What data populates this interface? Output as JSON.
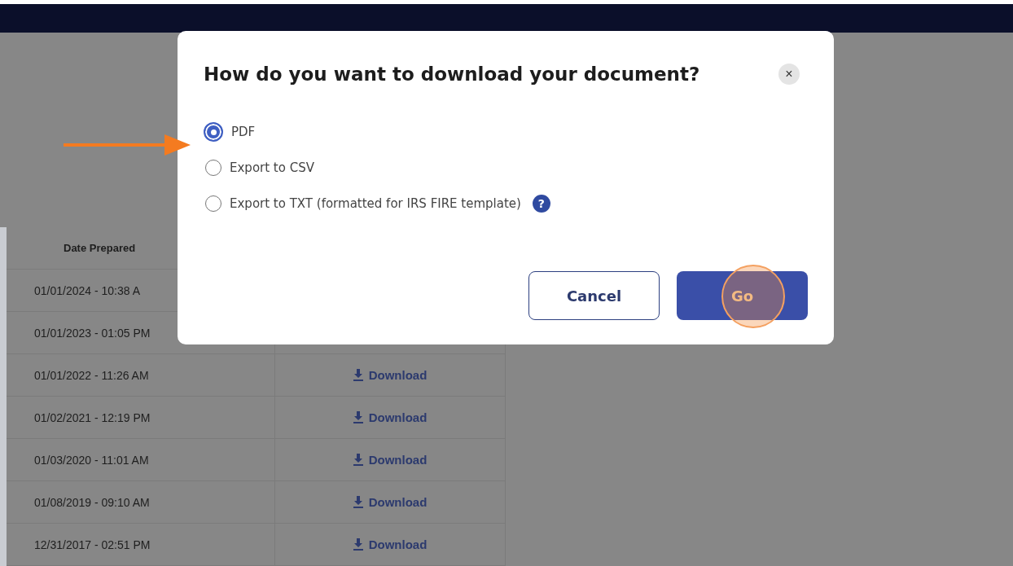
{
  "table": {
    "columns": [
      "Date Prepared"
    ],
    "rows": [
      {
        "date": "01/01/2024 - 10:38 A"
      },
      {
        "date": "01/01/2023 - 01:05 PM"
      },
      {
        "date": "01/01/2022 - 11:26 AM",
        "download": "Download"
      },
      {
        "date": "01/02/2021 - 12:19 PM",
        "download": "Download"
      },
      {
        "date": "01/03/2020 - 11:01 AM",
        "download": "Download"
      },
      {
        "date": "01/08/2019 - 09:10 AM",
        "download": "Download"
      },
      {
        "date": "12/31/2017 - 02:51 PM",
        "download": "Download"
      }
    ]
  },
  "dialog": {
    "title": "How do you want to download your document?",
    "close": "×",
    "options": [
      {
        "label": "PDF",
        "selected": true,
        "help": false
      },
      {
        "label": "Export to CSV",
        "selected": false,
        "help": false
      },
      {
        "label": "Export to TXT (formatted for IRS FIRE template)",
        "selected": false,
        "help": true
      }
    ],
    "help_icon": "?",
    "buttons": [
      {
        "label": "Cancel",
        "kind": "secondary"
      },
      {
        "label": "Go",
        "kind": "primary"
      }
    ]
  }
}
